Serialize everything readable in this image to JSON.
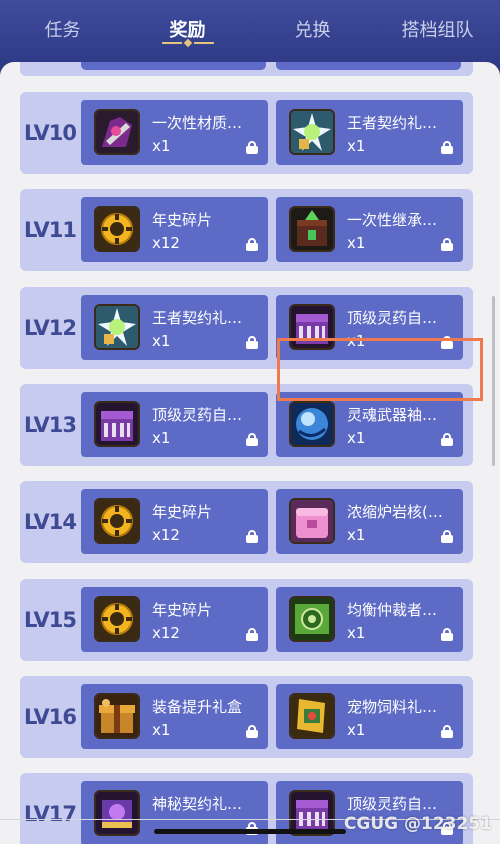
{
  "tabs": [
    {
      "label": "任务",
      "active": false
    },
    {
      "label": "奖励",
      "active": true
    },
    {
      "label": "兑换",
      "active": false
    },
    {
      "label": "搭档组队",
      "active": false
    }
  ],
  "rewards": [
    {
      "level": "LV10",
      "items": [
        {
          "name": "一次性材质…",
          "qty": "x1",
          "icon": "material-bag-icon"
        },
        {
          "name": "王者契约礼…",
          "qty": "x1",
          "icon": "king-contract-gift-icon"
        }
      ]
    },
    {
      "level": "LV11",
      "items": [
        {
          "name": "年史碎片",
          "qty": "x12",
          "icon": "chronicle-fragment-icon"
        },
        {
          "name": "一次性继承…",
          "qty": "x1",
          "icon": "inheritance-box-icon"
        }
      ]
    },
    {
      "level": "LV12",
      "items": [
        {
          "name": "王者契约礼…",
          "qty": "x1",
          "icon": "king-contract-gift-icon"
        },
        {
          "name": "顶级灵药自…",
          "qty": "x1",
          "icon": "elixir-chest-icon"
        }
      ]
    },
    {
      "level": "LV13",
      "items": [
        {
          "name": "顶级灵药自…",
          "qty": "x1",
          "icon": "elixir-chest-icon"
        },
        {
          "name": "灵魂武器袖…",
          "qty": "x1",
          "icon": "soul-weapon-orb-icon"
        }
      ]
    },
    {
      "level": "LV14",
      "items": [
        {
          "name": "年史碎片",
          "qty": "x12",
          "icon": "chronicle-fragment-icon"
        },
        {
          "name": "浓缩炉岩核(…",
          "qty": "x1",
          "icon": "furnace-core-chest-icon"
        }
      ]
    },
    {
      "level": "LV15",
      "items": [
        {
          "name": "年史碎片",
          "qty": "x12",
          "icon": "chronicle-fragment-icon"
        },
        {
          "name": "均衡仲裁者…",
          "qty": "x1",
          "icon": "arbiter-seal-icon"
        }
      ]
    },
    {
      "level": "LV16",
      "items": [
        {
          "name": "装备提升礼盒",
          "qty": "x1",
          "icon": "equipment-gift-box-icon"
        },
        {
          "name": "宠物饲料礼…",
          "qty": "x1",
          "icon": "pet-food-gift-icon"
        }
      ]
    },
    {
      "level": "LV17",
      "items": [
        {
          "name": "神秘契约礼…",
          "qty": "",
          "icon": "mystery-contract-icon"
        },
        {
          "name": "顶级灵药自…",
          "qty": "",
          "icon": "elixir-chest-icon"
        }
      ]
    }
  ],
  "watermark": "CGUG @123251",
  "colors": {
    "header": "#2e3a86",
    "row": "#c6cbef",
    "card": "#5d6ac6",
    "highlight": "#ef7a4d",
    "level_text": "#3f4a94"
  }
}
